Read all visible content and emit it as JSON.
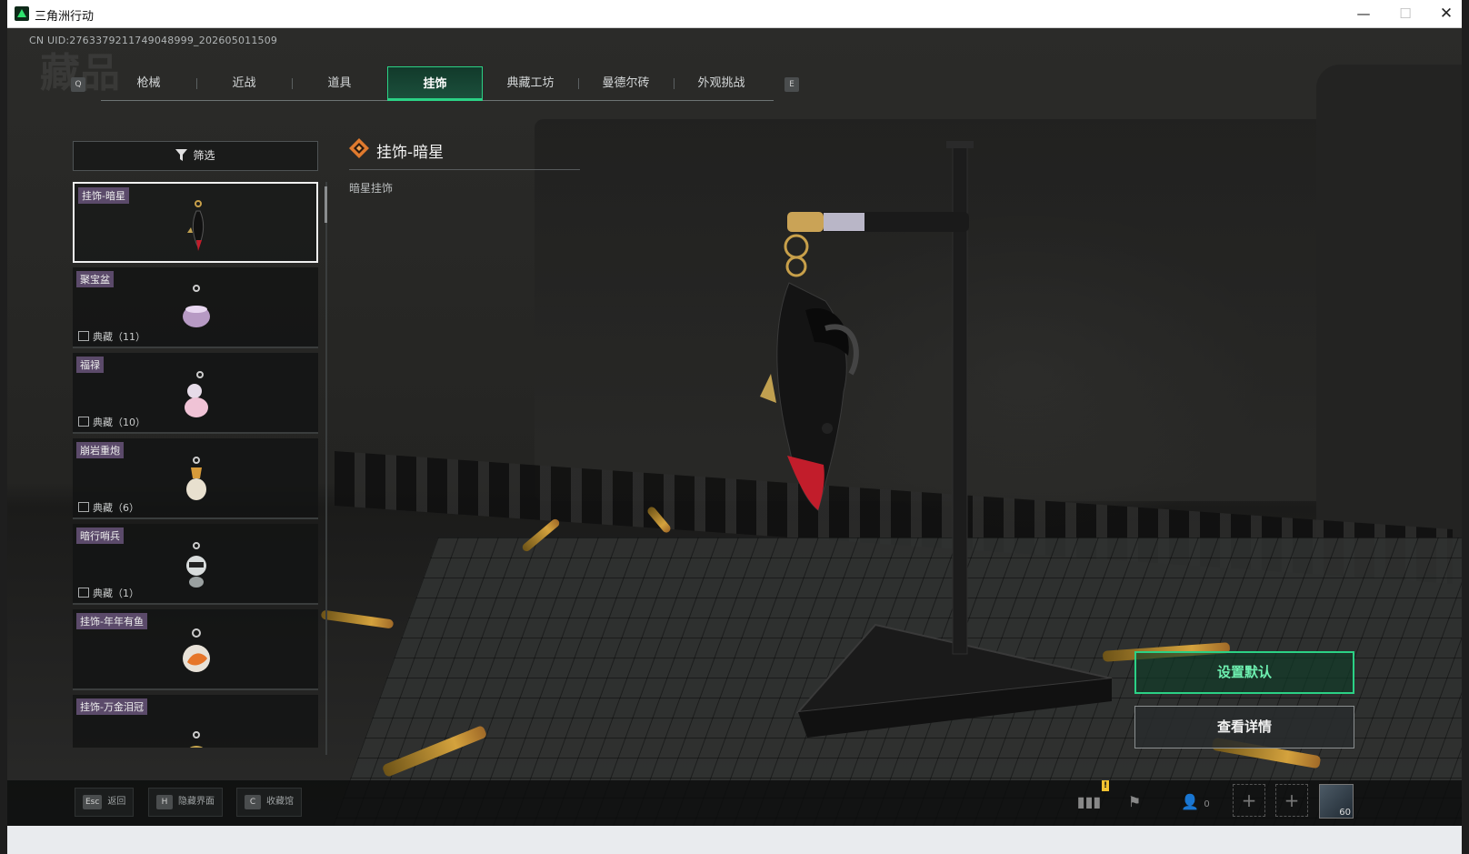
{
  "window": {
    "title": "三角洲行动",
    "minimize": "—",
    "maximize": "☐",
    "close": "✕"
  },
  "uid": "CN UID:2763379211749048999_202605011509",
  "page_bg_title": "藏品",
  "tabs": {
    "prev_key": "Q",
    "next_key": "E",
    "items": [
      {
        "label": "枪械",
        "active": false
      },
      {
        "label": "近战",
        "active": false
      },
      {
        "label": "道具",
        "active": false
      },
      {
        "label": "挂饰",
        "active": true
      },
      {
        "label": "典藏工坊",
        "active": false
      },
      {
        "label": "曼德尔砖",
        "active": false
      },
      {
        "label": "外观挑战",
        "active": false
      }
    ]
  },
  "filter": {
    "label": "筛选"
  },
  "items": [
    {
      "name": "挂饰-暗星",
      "tag": "",
      "selected": true
    },
    {
      "name": "聚宝盆",
      "tag": "典藏（11）",
      "selected": false
    },
    {
      "name": "福禄",
      "tag": "典藏（10）",
      "selected": false
    },
    {
      "name": "崩岩重炮",
      "tag": "典藏（6）",
      "selected": false
    },
    {
      "name": "暗行哨兵",
      "tag": "典藏（1）",
      "selected": false
    },
    {
      "name": "挂饰-年年有鱼",
      "tag": "",
      "selected": false
    },
    {
      "name": "挂饰-万金泪冠",
      "tag": "",
      "selected": false
    }
  ],
  "detail": {
    "title": "挂饰-暗星",
    "subtitle": "暗星挂饰"
  },
  "buttons": {
    "set_default": "设置默认",
    "view_details": "查看详情"
  },
  "bottom_hints": [
    {
      "key": "Esc",
      "label": "返回"
    },
    {
      "key": "H",
      "label": "隐藏界面"
    },
    {
      "key": "C",
      "label": "收藏馆"
    }
  ],
  "bottom_right": {
    "friends_count": "0",
    "avatar_level": "60",
    "warning": "!"
  },
  "colors": {
    "accent": "#2bd185",
    "tag_bg": "#5b4a6a"
  }
}
